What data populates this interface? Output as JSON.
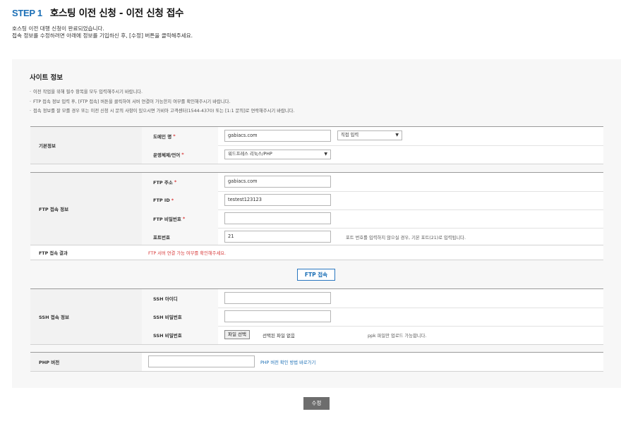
{
  "header": {
    "step": "STEP 1",
    "title": "호스팅 이전 신청 - 이전 신청 접수"
  },
  "intro": {
    "line1": "호스팅 이전 대행 신청이 완료되었습니다.",
    "line2": "접속 정보를 수정하려면 아래에 정보를 기입하신 후, [수정] 버튼을 클릭해주세요."
  },
  "section": {
    "title": "사이트 정보",
    "notes": [
      "이전 작업을 위해 필수 항목을 모두 입력해주시기 바랍니다.",
      "FTP 접속 정보 입력 후, [FTP 접속] 버튼을 클릭하여 서버 연결이 가능한지 여부를 확인해주시기 바랍니다.",
      "접속 정보를 잘 모를 경우 또는 이전 신청 시 문의 사항이 있으시면 가비아 고객센터(1544-4370) 또는 [1:1 문의]로 연락해주시기 바랍니다."
    ]
  },
  "basic": {
    "category": "기본정보",
    "domain_label": "도메인 명",
    "domain_value": "gabiacs.com",
    "domain_select": "직접 입력",
    "os_label": "운영체제/언어",
    "os_select": "워드프레스 리눅스/PHP",
    "required_mark": "*"
  },
  "ftp": {
    "category": "FTP 접속 정보",
    "addr_label": "FTP 주소",
    "addr_value": "gabiacs.com",
    "id_label": "FTP ID",
    "id_value": "testest123123",
    "pw_label": "FTP 비밀번호",
    "pw_value": "",
    "port_label": "포트번호",
    "port_value": "21",
    "port_hint": "포트 번호를 입력하지 않으실 경우, 기본 포트(21)로 입력됩니다.",
    "result_label": "FTP 접속 결과",
    "result_text": "FTP 서버 연결 가능 여부를 확인해주세요.",
    "connect_button": "FTP 접속"
  },
  "ssh": {
    "category": "SSH 접속 정보",
    "id_label": "SSH 아이디",
    "id_value": "",
    "pw_label": "SSH 비밀번호",
    "pw_value": "",
    "key_label": "SSH 비밀번호",
    "file_button": "파일 선택",
    "file_status": "선택된 파일 없음",
    "file_hint": "ppk 파일만 업로드 가능합니다."
  },
  "php": {
    "category": "PHP 버전",
    "value": "",
    "link": "PHP 버전 확인 방법 바로가기"
  },
  "submit_button": "수정",
  "colors": {
    "accent": "#1b6fb6",
    "error": "#d83a3a",
    "button_gray": "#6d6d6d"
  }
}
